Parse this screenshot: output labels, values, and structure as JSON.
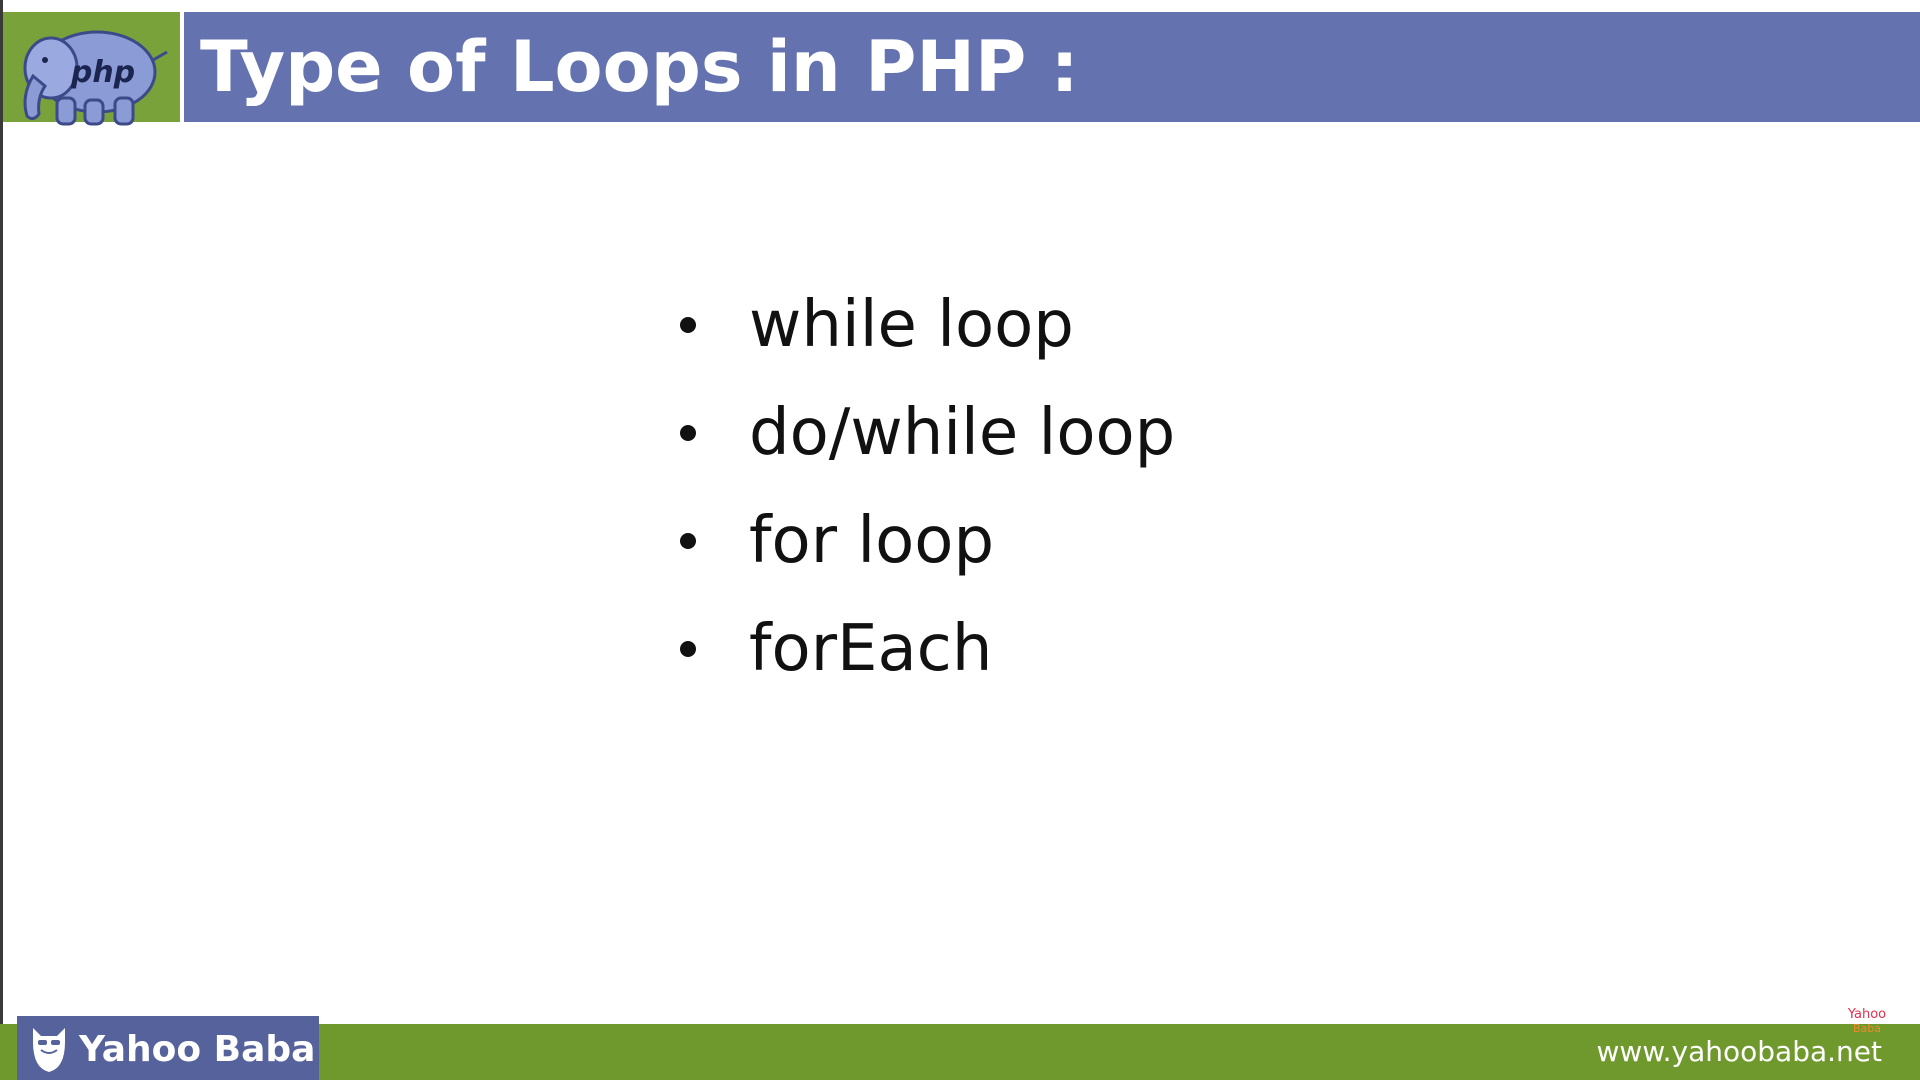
{
  "header": {
    "logo_text": "php",
    "title": "Type of Loops in PHP :"
  },
  "bullets": [
    "while loop",
    "do/while loop",
    "for loop",
    "forEach"
  ],
  "footer": {
    "brand": "Yahoo Baba",
    "url": "www.yahoobaba.net",
    "watermark_top": "Yahoo",
    "watermark_bottom": "Baba"
  },
  "colors": {
    "header_bar": "#6473b0",
    "logo_bg": "#7aa23a",
    "footer_bar": "#6f992c",
    "brand_box": "#56629b",
    "text": "#111111"
  },
  "icons": {
    "logo": "php-elephant-icon",
    "brand": "bearded-man-icon"
  }
}
